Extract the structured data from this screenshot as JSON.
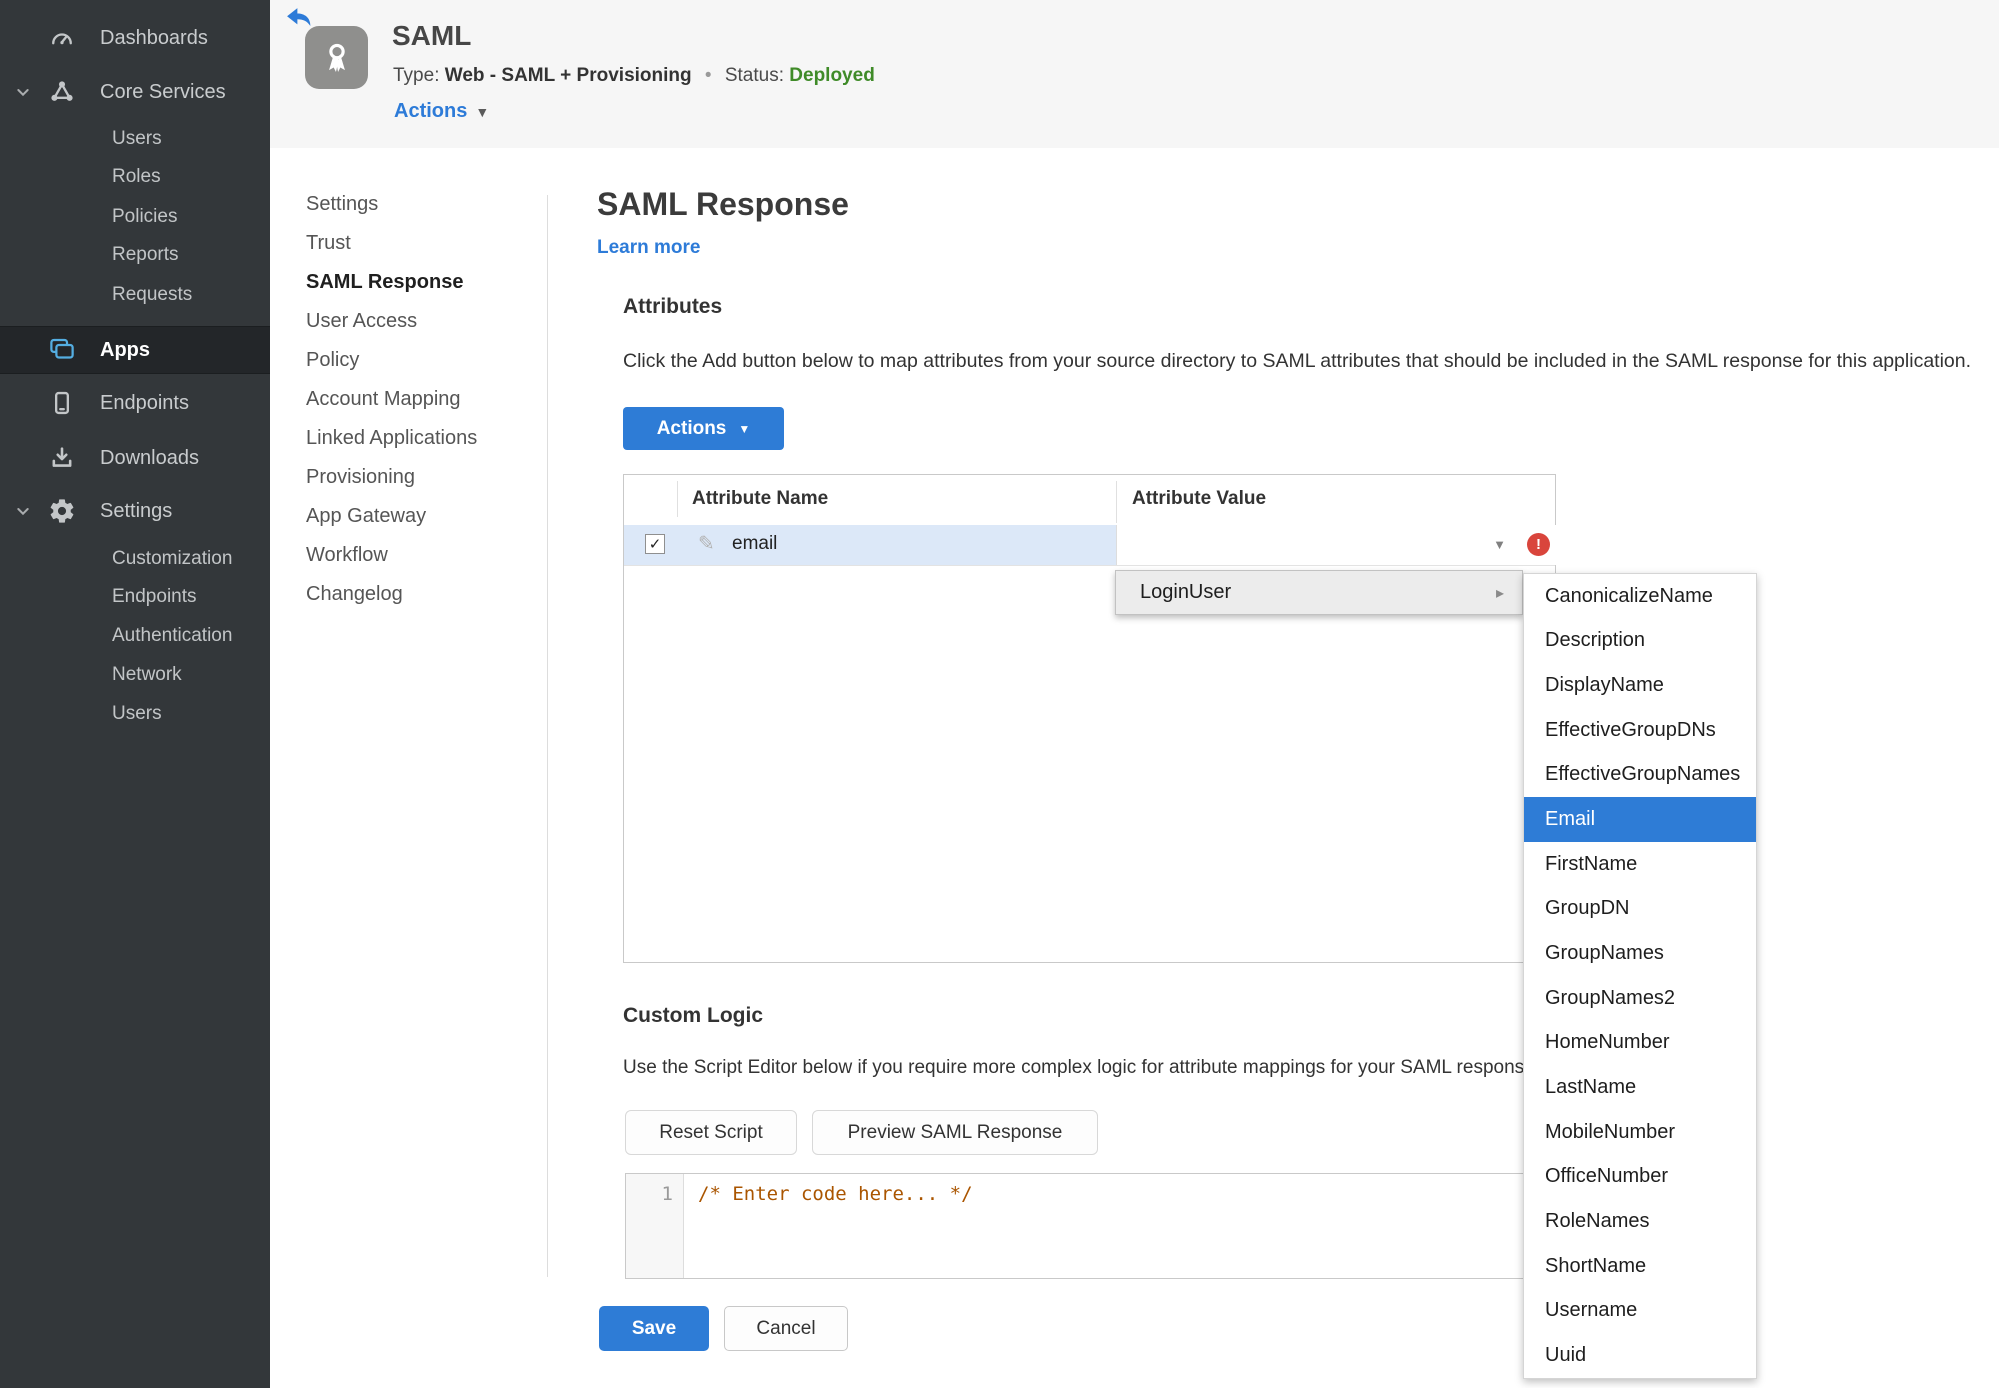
{
  "sidebar": {
    "items": [
      {
        "label": "Dashboards",
        "icon": "gauge-icon"
      },
      {
        "label": "Core Services",
        "icon": "core-services-icon",
        "expanded": true
      },
      {
        "label": "Users"
      },
      {
        "label": "Roles"
      },
      {
        "label": "Policies"
      },
      {
        "label": "Reports"
      },
      {
        "label": "Requests"
      },
      {
        "label": "Apps",
        "icon": "apps-icon",
        "active": true
      },
      {
        "label": "Endpoints",
        "icon": "phone-icon"
      },
      {
        "label": "Downloads",
        "icon": "download-icon"
      },
      {
        "label": "Settings",
        "icon": "gear-icon",
        "expanded": true
      },
      {
        "label": "Customization"
      },
      {
        "label": "Endpoints"
      },
      {
        "label": "Authentication"
      },
      {
        "label": "Network"
      },
      {
        "label": "Users"
      }
    ]
  },
  "header": {
    "title": "SAML",
    "type_label": "Type:",
    "type_value": "Web - SAML + Provisioning",
    "separator": "•",
    "status_label": "Status:",
    "status_value": "Deployed",
    "actions_label": "Actions"
  },
  "subnav": {
    "items": [
      {
        "label": "Settings"
      },
      {
        "label": "Trust"
      },
      {
        "label": "SAML Response",
        "active": true
      },
      {
        "label": "User Access"
      },
      {
        "label": "Policy"
      },
      {
        "label": "Account Mapping"
      },
      {
        "label": "Linked Applications"
      },
      {
        "label": "Provisioning"
      },
      {
        "label": "App Gateway"
      },
      {
        "label": "Workflow"
      },
      {
        "label": "Changelog"
      }
    ]
  },
  "main": {
    "title": "SAML Response",
    "learn_more": "Learn more",
    "attributes": {
      "heading": "Attributes",
      "description": "Click the Add button below to map attributes from your source directory to SAML attributes that should be included in the SAML response for this application.",
      "actions_button": "Actions",
      "table": {
        "columns": [
          "Attribute Name",
          "Attribute Value"
        ],
        "rows": [
          {
            "name": "email",
            "checked": true,
            "value": "",
            "error": true
          }
        ]
      }
    },
    "dropdown": {
      "label": "LoginUser",
      "selected": "Email",
      "submenu": [
        {
          "label": "CanonicalizeName"
        },
        {
          "label": "Description"
        },
        {
          "label": "DisplayName"
        },
        {
          "label": "EffectiveGroupDNs"
        },
        {
          "label": "EffectiveGroupNames"
        },
        {
          "label": "Email",
          "selected": true
        },
        {
          "label": "FirstName"
        },
        {
          "label": "GroupDN"
        },
        {
          "label": "GroupNames"
        },
        {
          "label": "GroupNames2"
        },
        {
          "label": "HomeNumber"
        },
        {
          "label": "LastName"
        },
        {
          "label": "MobileNumber"
        },
        {
          "label": "OfficeNumber"
        },
        {
          "label": "RoleNames"
        },
        {
          "label": "ShortName"
        },
        {
          "label": "Username"
        },
        {
          "label": "Uuid"
        }
      ]
    },
    "custom_logic": {
      "heading": "Custom Logic",
      "description": "Use the Script Editor below if you require more complex logic for attribute mappings for your SAML response.",
      "reset_button": "Reset Script",
      "preview_button": "Preview SAML Response",
      "editor": {
        "line_number": "1",
        "code": "/* Enter code here... */"
      }
    },
    "save_button": "Save",
    "cancel_button": "Cancel"
  },
  "icons": {
    "check": "✓",
    "pencil": "✎",
    "caret_down": "▼",
    "caret_down_small": "▾",
    "caret_right": "▸",
    "error_mark": "!"
  },
  "colors": {
    "accent_blue": "#2e7cd6",
    "link_blue": "#2d7bd8",
    "status_green": "#3f8b28",
    "sidebar_bg": "#33373a",
    "sidebar_active_bg": "#232629",
    "apps_icon_blue": "#54aee2",
    "row_highlight_blue": "#dce8f8",
    "error_red": "#d9453c",
    "code_comment": "#aa5500",
    "header_band_bg": "#f6f6f6"
  }
}
